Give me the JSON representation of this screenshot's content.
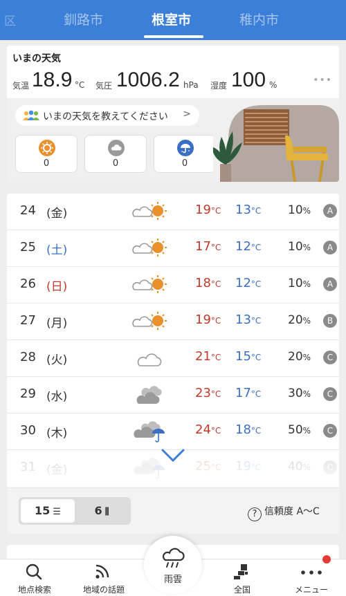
{
  "tabs": {
    "ghost": "区",
    "items": [
      {
        "label": "釧路市"
      },
      {
        "label": "根室市"
      },
      {
        "label": "稚内市"
      }
    ],
    "active_index": 1
  },
  "current": {
    "title": "いまの天気",
    "temp_label": "気温",
    "temp_value": "18.9",
    "temp_unit": "°C",
    "pressure_label": "気圧",
    "pressure_value": "1006.2",
    "pressure_unit": "hPa",
    "humidity_label": "湿度",
    "humidity_value": "100",
    "humidity_unit": "%",
    "more": "•••",
    "report_prompt": "いまの天気を教えてください",
    "report_chevron": ">",
    "counts": [
      {
        "icon": "sun-icon",
        "value": "0"
      },
      {
        "icon": "cloud-icon",
        "value": "0"
      },
      {
        "icon": "umbrella-icon",
        "value": "0"
      }
    ]
  },
  "forecast": {
    "deg_unit": "°C",
    "pop_unit": "%",
    "rows": [
      {
        "date": "24",
        "dow": "(金)",
        "dow_type": "weekday",
        "icon": "cloud-sun-icon",
        "high": "19",
        "low": "13",
        "pop": "10",
        "reliability": "A"
      },
      {
        "date": "25",
        "dow": "(土)",
        "dow_type": "sat",
        "icon": "cloud-sun-icon",
        "high": "17",
        "low": "12",
        "pop": "10",
        "reliability": "A"
      },
      {
        "date": "26",
        "dow": "(日)",
        "dow_type": "sun",
        "icon": "cloud-sun-icon",
        "high": "18",
        "low": "12",
        "pop": "10",
        "reliability": "A"
      },
      {
        "date": "27",
        "dow": "(月)",
        "dow_type": "weekday",
        "icon": "cloud-sun-icon",
        "high": "19",
        "low": "13",
        "pop": "20",
        "reliability": "B"
      },
      {
        "date": "28",
        "dow": "(火)",
        "dow_type": "weekday",
        "icon": "cloud-icon",
        "high": "21",
        "low": "15",
        "pop": "20",
        "reliability": "C"
      },
      {
        "date": "29",
        "dow": "(水)",
        "dow_type": "weekday",
        "icon": "dark-cloud-icon",
        "high": "23",
        "low": "17",
        "pop": "30",
        "reliability": "C"
      },
      {
        "date": "30",
        "dow": "(木)",
        "dow_type": "weekday",
        "icon": "cloud-rain-icon",
        "high": "24",
        "low": "18",
        "pop": "50",
        "reliability": "C"
      },
      {
        "date": "31",
        "dow": "(金)",
        "dow_type": "weekday",
        "icon": "cloud-rain-icon",
        "high": "25",
        "low": "19",
        "pop": "40",
        "reliability": "C"
      }
    ],
    "view_15_label": "15",
    "view_15_glyph": "☰",
    "view_6_label": "6",
    "view_6_glyph": "⫼",
    "reliability_help_icon": "?",
    "reliability_help": "信頼度 A〜C"
  },
  "nav": {
    "search": "地点検索",
    "topics": "地域の話題",
    "rain": "雨雲",
    "national": "全国",
    "menu": "メニュー"
  },
  "colors": {
    "accent": "#3b7fd8",
    "high_temp": "#c0392b",
    "low_temp": "#3a6fc4",
    "sun": "#e8902c"
  }
}
